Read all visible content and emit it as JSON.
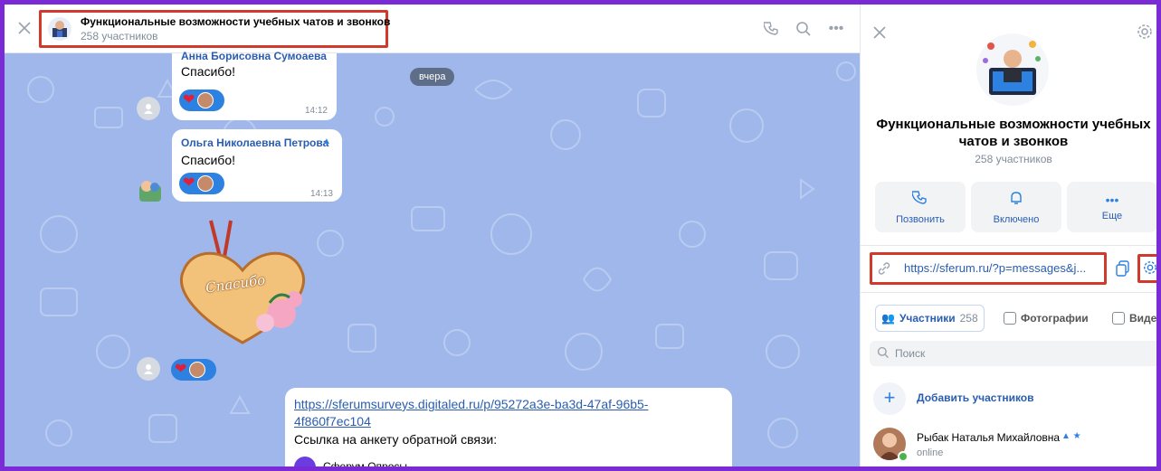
{
  "chat_header": {
    "title": "Функциональные возможности учебных чатов и звонков",
    "subtitle": "258 участников",
    "icons": [
      "close-icon",
      "phone-icon",
      "search-icon",
      "more-icon"
    ]
  },
  "date_divider": "вчера",
  "messages": [
    {
      "author": "Анна Борисовна Сумоаева",
      "text": "Спасибо!",
      "time": "14:12"
    },
    {
      "author": "Ольга Николаевна Петрова",
      "text": "Спасибо!",
      "time": "14:13"
    }
  ],
  "sticker_text": "Спасибо",
  "link_message": {
    "url_line1": "https://sferumsurveys.digitaled.ru/p/95272a3e-ba3d-47af-96b5-",
    "url_line2": "4f860f7ec104",
    "text": "Ссылка на анкету обратной связи:",
    "attachment": "Сферум Опросы"
  },
  "side_panel": {
    "title_line1": "Функциональные возможности учебных",
    "title_line2": "чатов и звонков",
    "members": "258 участников",
    "actions": [
      {
        "label": "Позвонить",
        "icon": "phone-icon"
      },
      {
        "label": "Включено",
        "icon": "bell-icon"
      },
      {
        "label": "Еще",
        "icon": "more-icon"
      }
    ],
    "invite_link": "https://sferum.ru/?p=messages&j...",
    "tabs": [
      {
        "label": "Участники",
        "count": "258"
      },
      {
        "label": "Фотографии"
      },
      {
        "label": "Виде"
      }
    ],
    "search_placeholder": "Поиск",
    "add_members": "Добавить участников",
    "member": {
      "name": "Рыбак Наталья Михайловна",
      "status": "online"
    }
  },
  "colors": {
    "accent": "#2d81e0",
    "highlight": "#d13a2a",
    "frame": "#7a2bd6",
    "chat_bg": "#9fb7ea"
  }
}
